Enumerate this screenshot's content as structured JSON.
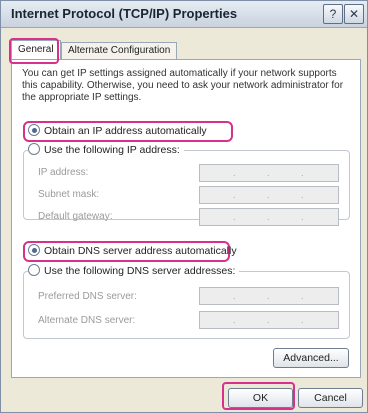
{
  "window": {
    "title": "Internet Protocol (TCP/IP) Properties",
    "help_button": "?",
    "close_button": "✕"
  },
  "tabs": [
    {
      "label": "General",
      "selected": true
    },
    {
      "label": "Alternate Configuration",
      "selected": false
    }
  ],
  "intro_text": "You can get IP settings assigned automatically if your network supports this capability. Otherwise, you need to ask your network administrator for the appropriate IP settings.",
  "ip_section": {
    "auto_option": "Obtain an IP address automatically",
    "manual_option": "Use the following IP address:",
    "auto_selected": true,
    "fields": [
      {
        "label": "IP address:"
      },
      {
        "label": "Subnet mask:"
      },
      {
        "label": "Default gateway:"
      }
    ]
  },
  "dns_section": {
    "auto_option": "Obtain DNS server address automatically",
    "manual_option": "Use the following DNS server addresses:",
    "auto_selected": true,
    "fields": [
      {
        "label": "Preferred DNS server:"
      },
      {
        "label": "Alternate DNS server:"
      }
    ]
  },
  "buttons": {
    "advanced": "Advanced...",
    "ok": "OK",
    "cancel": "Cancel"
  },
  "colors": {
    "highlight": "#d6318c",
    "window_bg": "#ece9d8"
  }
}
